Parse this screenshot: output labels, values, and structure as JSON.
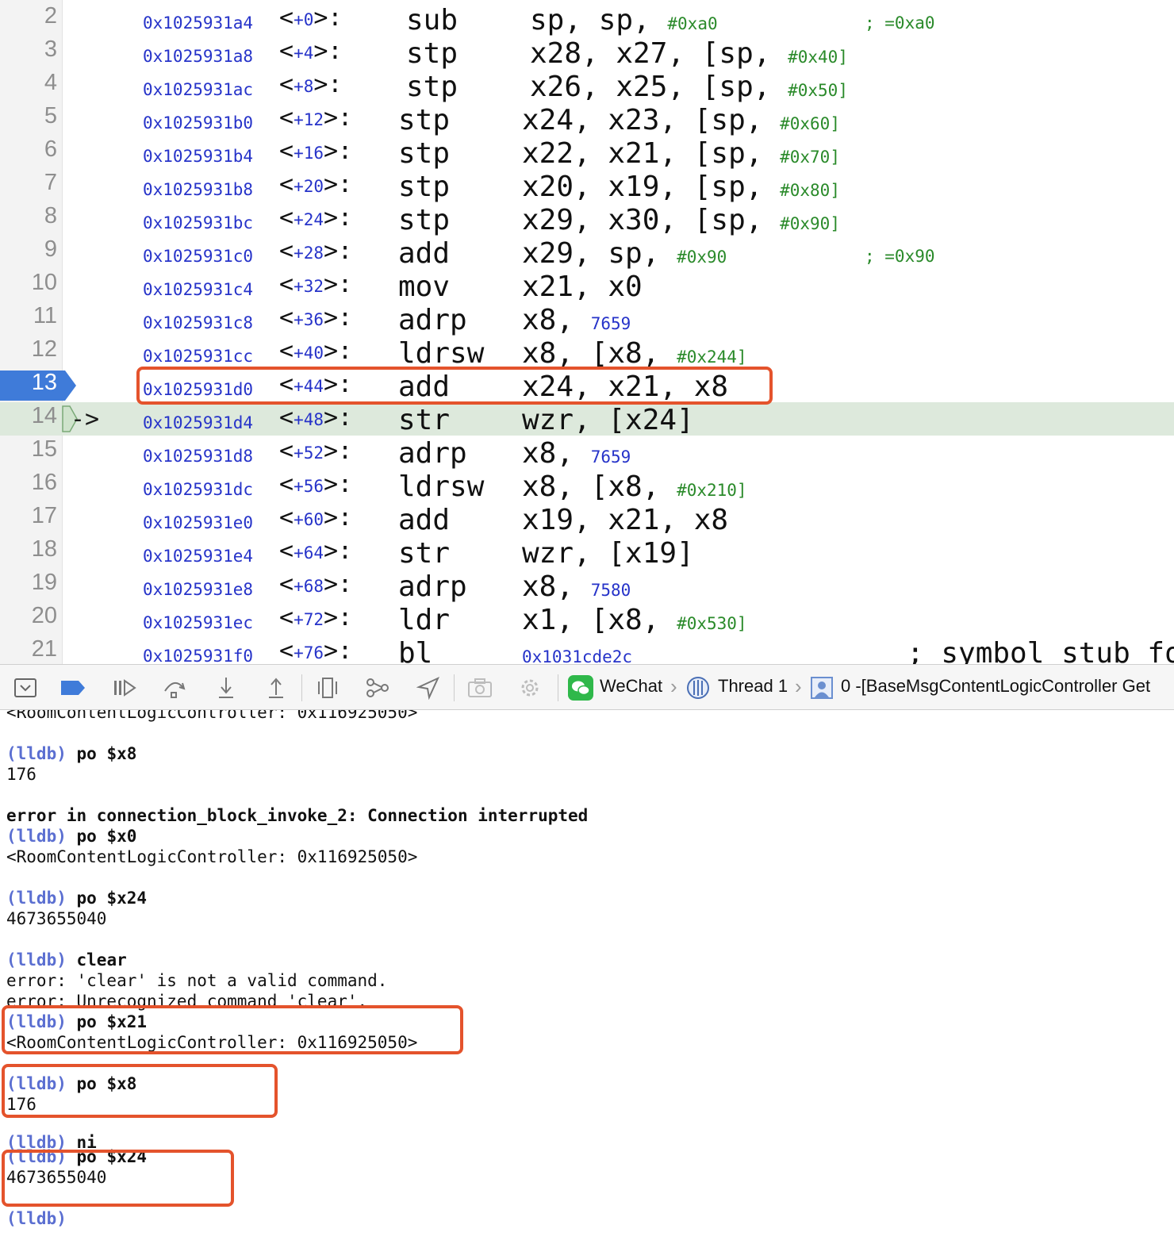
{
  "disassembly": {
    "rows": [
      {
        "line": "2",
        "addr": "0x1025931a4",
        "off": "+0",
        "mnemonic": "sub",
        "ops": "sp, sp, ",
        "imm": "#0xa0",
        "comment": "; =0xa0"
      },
      {
        "line": "3",
        "addr": "0x1025931a8",
        "off": "+4",
        "mnemonic": "stp",
        "ops": "x28, x27, [sp, ",
        "imm": "#0x40]"
      },
      {
        "line": "4",
        "addr": "0x1025931ac",
        "off": "+8",
        "mnemonic": "stp",
        "ops": "x26, x25, [sp, ",
        "imm": "#0x50]"
      },
      {
        "line": "5",
        "addr": "0x1025931b0",
        "off": "+12",
        "mnemonic": "stp",
        "ops": "x24, x23, [sp, ",
        "imm": "#0x60]"
      },
      {
        "line": "6",
        "addr": "0x1025931b4",
        "off": "+16",
        "mnemonic": "stp",
        "ops": "x22, x21, [sp, ",
        "imm": "#0x70]"
      },
      {
        "line": "7",
        "addr": "0x1025931b8",
        "off": "+20",
        "mnemonic": "stp",
        "ops": "x20, x19, [sp, ",
        "imm": "#0x80]"
      },
      {
        "line": "8",
        "addr": "0x1025931bc",
        "off": "+24",
        "mnemonic": "stp",
        "ops": "x29, x30, [sp, ",
        "imm": "#0x90]"
      },
      {
        "line": "9",
        "addr": "0x1025931c0",
        "off": "+28",
        "mnemonic": "add",
        "ops": "x29, sp, ",
        "imm": "#0x90",
        "comment": "; =0x90"
      },
      {
        "line": "10",
        "addr": "0x1025931c4",
        "off": "+32",
        "mnemonic": "mov",
        "ops": "x21, x0"
      },
      {
        "line": "11",
        "addr": "0x1025931c8",
        "off": "+36",
        "mnemonic": "adrp",
        "ops": "x8, ",
        "target": "7659"
      },
      {
        "line": "12",
        "addr": "0x1025931cc",
        "off": "+40",
        "mnemonic": "ldrsw",
        "ops": "x8, [x8, ",
        "imm": "#0x244]"
      },
      {
        "line": "13",
        "addr": "0x1025931d0",
        "off": "+44",
        "mnemonic": "add",
        "ops": "x24, x21, x8",
        "breakpoint": true
      },
      {
        "line": "14",
        "addr": "0x1025931d4",
        "off": "+48",
        "mnemonic": "str",
        "ops": "wzr, [x24]",
        "current": true,
        "pc_arrow": "->"
      },
      {
        "line": "15",
        "addr": "0x1025931d8",
        "off": "+52",
        "mnemonic": "adrp",
        "ops": "x8, ",
        "target": "7659"
      },
      {
        "line": "16",
        "addr": "0x1025931dc",
        "off": "+56",
        "mnemonic": "ldrsw",
        "ops": "x8, [x8, ",
        "imm": "#0x210]"
      },
      {
        "line": "17",
        "addr": "0x1025931e0",
        "off": "+60",
        "mnemonic": "add",
        "ops": "x19, x21, x8"
      },
      {
        "line": "18",
        "addr": "0x1025931e4",
        "off": "+64",
        "mnemonic": "str",
        "ops": "wzr, [x19]"
      },
      {
        "line": "19",
        "addr": "0x1025931e8",
        "off": "+68",
        "mnemonic": "adrp",
        "ops": "x8, ",
        "target": "7580"
      },
      {
        "line": "20",
        "addr": "0x1025931ec",
        "off": "+72",
        "mnemonic": "ldr",
        "ops": "x1, [x8, ",
        "imm": "#0x530]"
      },
      {
        "line": "21",
        "addr": "0x1025931f0",
        "off": "+76",
        "mnemonic": "bl",
        "ops": "",
        "target": "0x1031cde2c",
        "symbol": "; symbol stub fo"
      }
    ]
  },
  "toolbar": {
    "buttons": [
      "hide-debug-area-icon",
      "breakpoints-toggle-icon",
      "continue-icon",
      "step-over-icon",
      "step-into-icon",
      "step-out-icon",
      "view-hierarchy-icon",
      "memory-graph-icon",
      "simulate-location-icon",
      "camera-icon",
      "environment-overrides-icon"
    ],
    "app_name": "WeChat",
    "thread_name": "Thread 1",
    "frame": "0 -[BaseMsgContentLogicController Get"
  },
  "console": {
    "lines": [
      {
        "kind": "output",
        "text": "<RoomContentLogicController: 0x116925050>"
      },
      {
        "kind": "blank"
      },
      {
        "kind": "cmd",
        "prompt": "(lldb)",
        "text": "po $x8"
      },
      {
        "kind": "output",
        "text": "176"
      },
      {
        "kind": "blank"
      },
      {
        "kind": "bold",
        "text": "error in connection_block_invoke_2: Connection interrupted"
      },
      {
        "kind": "cmd",
        "prompt": "(lldb)",
        "text": "po $x0"
      },
      {
        "kind": "output",
        "text": "<RoomContentLogicController: 0x116925050>"
      },
      {
        "kind": "blank"
      },
      {
        "kind": "cmd",
        "prompt": "(lldb)",
        "text": "po $x24"
      },
      {
        "kind": "output",
        "text": "4673655040"
      },
      {
        "kind": "blank"
      },
      {
        "kind": "cmd",
        "prompt": "(lldb)",
        "text": "clear"
      },
      {
        "kind": "output",
        "text": "error: 'clear' is not a valid command."
      },
      {
        "kind": "output",
        "text": "error: Unrecognized command 'clear'."
      },
      {
        "kind": "cmd",
        "prompt": "(lldb)",
        "text": "po $x21"
      },
      {
        "kind": "output",
        "text": "<RoomContentLogicController: 0x116925050>"
      },
      {
        "kind": "blank"
      },
      {
        "kind": "cmd",
        "prompt": "(lldb)",
        "text": "po $x8"
      },
      {
        "kind": "output",
        "text": "176"
      },
      {
        "kind": "blank"
      },
      {
        "kind": "cmd",
        "prompt": "(lldb)",
        "text": "ni"
      },
      {
        "kind": "cmd",
        "prompt": "(lldb)",
        "text": "po $x24"
      },
      {
        "kind": "output",
        "text": "4673655040"
      },
      {
        "kind": "blank"
      },
      {
        "kind": "prompt",
        "prompt": "(lldb)"
      }
    ]
  },
  "colors": {
    "address_blue": "#2633c9",
    "immediate_green": "#2a8a2a",
    "breakpoint_blue": "#3f7bd9",
    "current_line_green": "#dde9dc",
    "annotation_orange": "#e4532c",
    "lldb_prompt": "#5b6fd1"
  }
}
